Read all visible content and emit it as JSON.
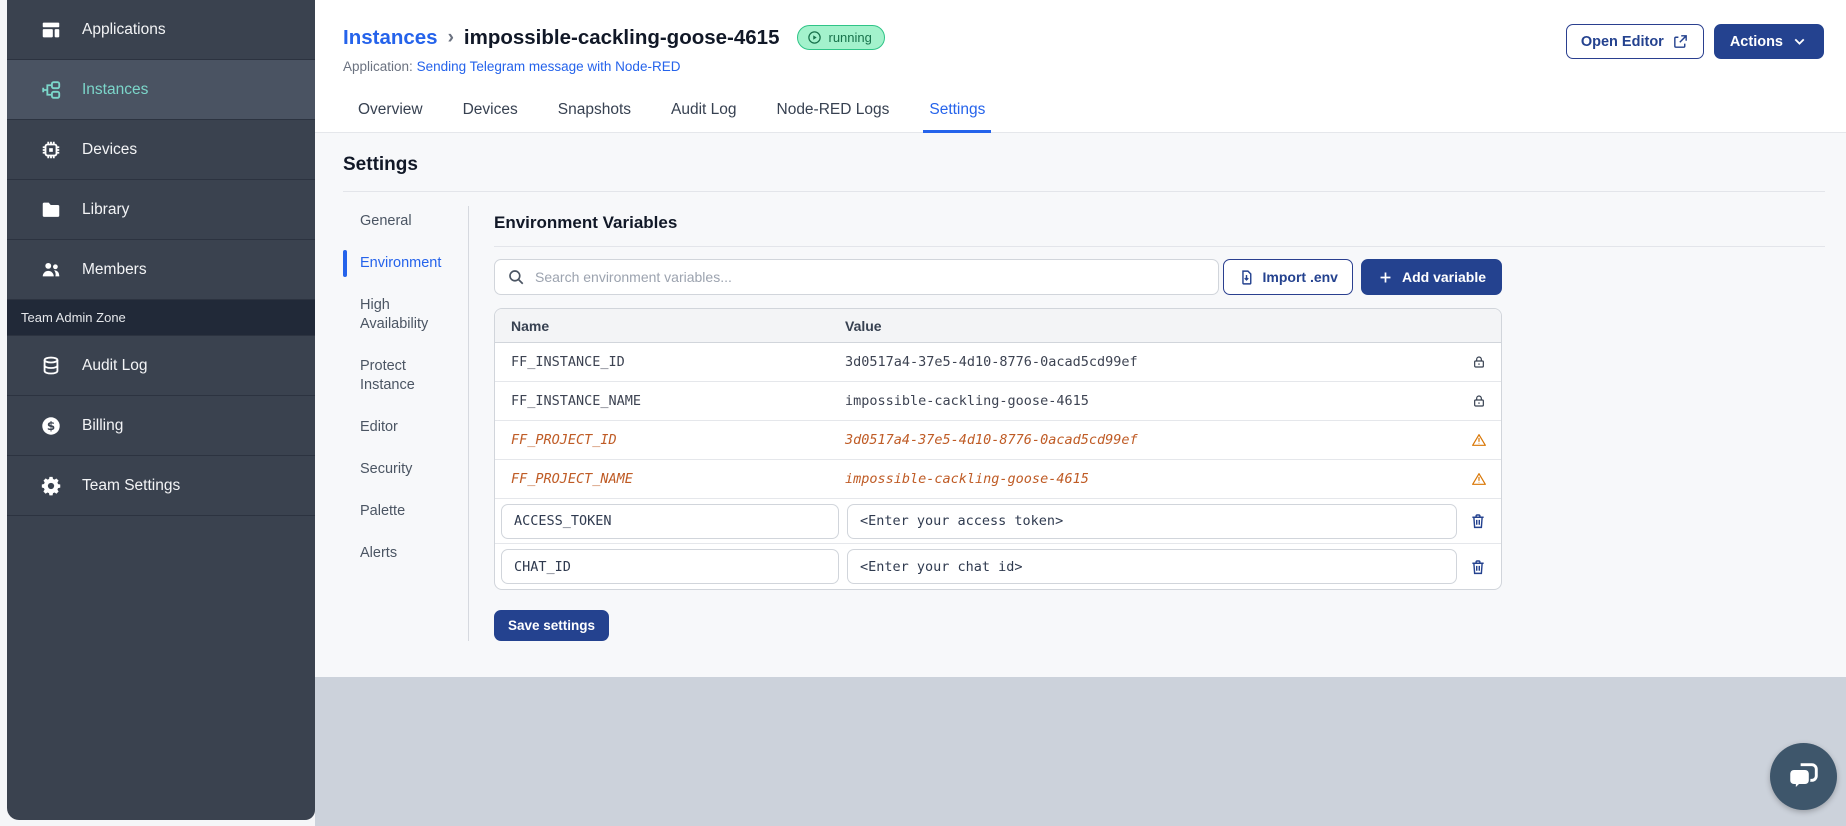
{
  "sidebar": {
    "items": [
      {
        "label": "Applications",
        "icon": "applications-icon",
        "active": false
      },
      {
        "label": "Instances",
        "icon": "instances-icon",
        "active": true
      },
      {
        "label": "Devices",
        "icon": "devices-icon",
        "active": false
      },
      {
        "label": "Library",
        "icon": "library-icon",
        "active": false
      },
      {
        "label": "Members",
        "icon": "members-icon",
        "active": false
      },
      {
        "label": "Team Admin Zone",
        "type": "section"
      },
      {
        "label": "Audit Log",
        "icon": "audit-log-icon",
        "active": false
      },
      {
        "label": "Billing",
        "icon": "billing-icon",
        "active": false
      },
      {
        "label": "Team Settings",
        "icon": "team-settings-icon",
        "active": false
      }
    ]
  },
  "header": {
    "breadcrumb_parent": "Instances",
    "breadcrumb_separator": "›",
    "title": "impossible-cackling-goose-4615",
    "status_badge": "running",
    "application_label": "Application:",
    "application_link": "Sending Telegram message with Node-RED",
    "open_editor_label": "Open Editor",
    "actions_label": "Actions"
  },
  "tabs": [
    {
      "label": "Overview",
      "active": false
    },
    {
      "label": "Devices",
      "active": false
    },
    {
      "label": "Snapshots",
      "active": false
    },
    {
      "label": "Audit Log",
      "active": false
    },
    {
      "label": "Node-RED Logs",
      "active": false
    },
    {
      "label": "Settings",
      "active": true
    }
  ],
  "settings": {
    "title": "Settings",
    "nav": [
      {
        "label": "General",
        "active": false
      },
      {
        "label": "Environment",
        "active": true
      },
      {
        "label": "High Availability",
        "active": false
      },
      {
        "label": "Protect Instance",
        "active": false
      },
      {
        "label": "Editor",
        "active": false
      },
      {
        "label": "Security",
        "active": false
      },
      {
        "label": "Palette",
        "active": false
      },
      {
        "label": "Alerts",
        "active": false
      }
    ]
  },
  "environment": {
    "title": "Environment Variables",
    "search_placeholder": "Search environment variables...",
    "import_button": "Import .env",
    "add_button": "Add variable",
    "save_button": "Save settings",
    "table": {
      "columns": [
        "Name",
        "Value"
      ],
      "rows": [
        {
          "name": "FF_INSTANCE_ID",
          "value": "3d0517a4-37e5-4d10-8776-0acad5cd99ef",
          "state": "locked"
        },
        {
          "name": "FF_INSTANCE_NAME",
          "value": "impossible-cackling-goose-4615",
          "state": "locked"
        },
        {
          "name": "FF_PROJECT_ID",
          "value": "3d0517a4-37e5-4d10-8776-0acad5cd99ef",
          "state": "deprecated"
        },
        {
          "name": "FF_PROJECT_NAME",
          "value": "impossible-cackling-goose-4615",
          "state": "deprecated"
        },
        {
          "name": "ACCESS_TOKEN",
          "value": "<Enter your access token>",
          "state": "editable"
        },
        {
          "name": "CHAT_ID",
          "value": "<Enter your chat id>",
          "state": "editable"
        }
      ]
    }
  },
  "colors": {
    "sidebar_background": "#3a424f",
    "sidebar_active_background": "#4a5362",
    "sidebar_active_text": "#7cd6ca",
    "admin_zone_background": "#212938",
    "primary_button": "#24428f",
    "link": "#2563eb",
    "running_badge_background": "#a3f2cc",
    "running_badge_border": "#2fc487",
    "running_badge_text": "#17724b",
    "deprecated_text": "#bf5b25",
    "warning_icon": "#d97706",
    "footer_background": "#ccd2db"
  }
}
